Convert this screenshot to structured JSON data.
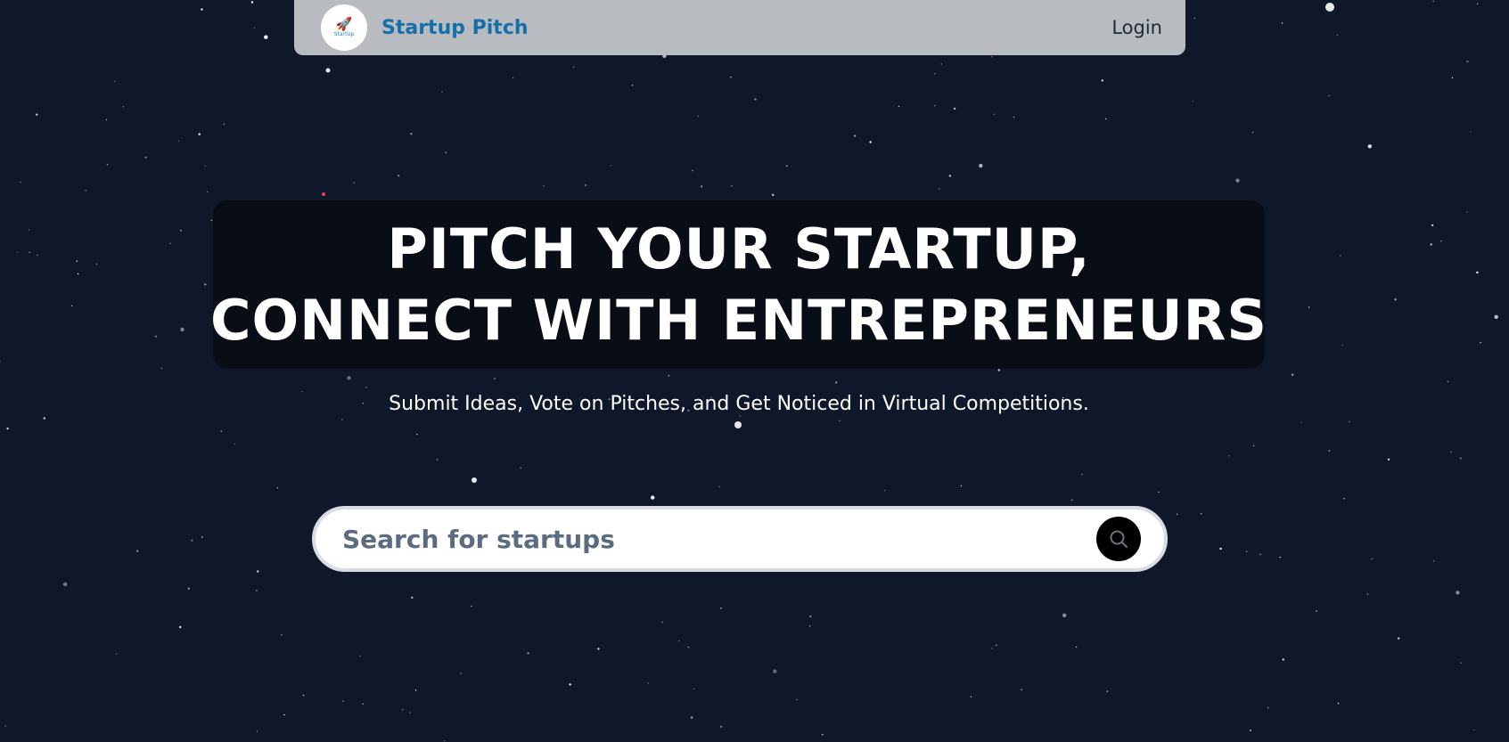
{
  "colors": {
    "background": "#0f172a",
    "navbar": "#b8bbc0",
    "brand": "#1670a8",
    "hero_box": "#090d16",
    "search_button": "#000000"
  },
  "navbar": {
    "logo_text": "Startup",
    "brand": "Startup Pitch",
    "login_label": "Login"
  },
  "hero": {
    "line1": "PITCH YOUR STARTUP,",
    "line2": "CONNECT WITH ENTREPRENEURS",
    "subtitle": "Submit Ideas, Vote on Pitches, and Get Noticed in Virtual Competitions."
  },
  "search": {
    "placeholder": "Search for startups",
    "value": "",
    "button_icon": "search-icon"
  }
}
